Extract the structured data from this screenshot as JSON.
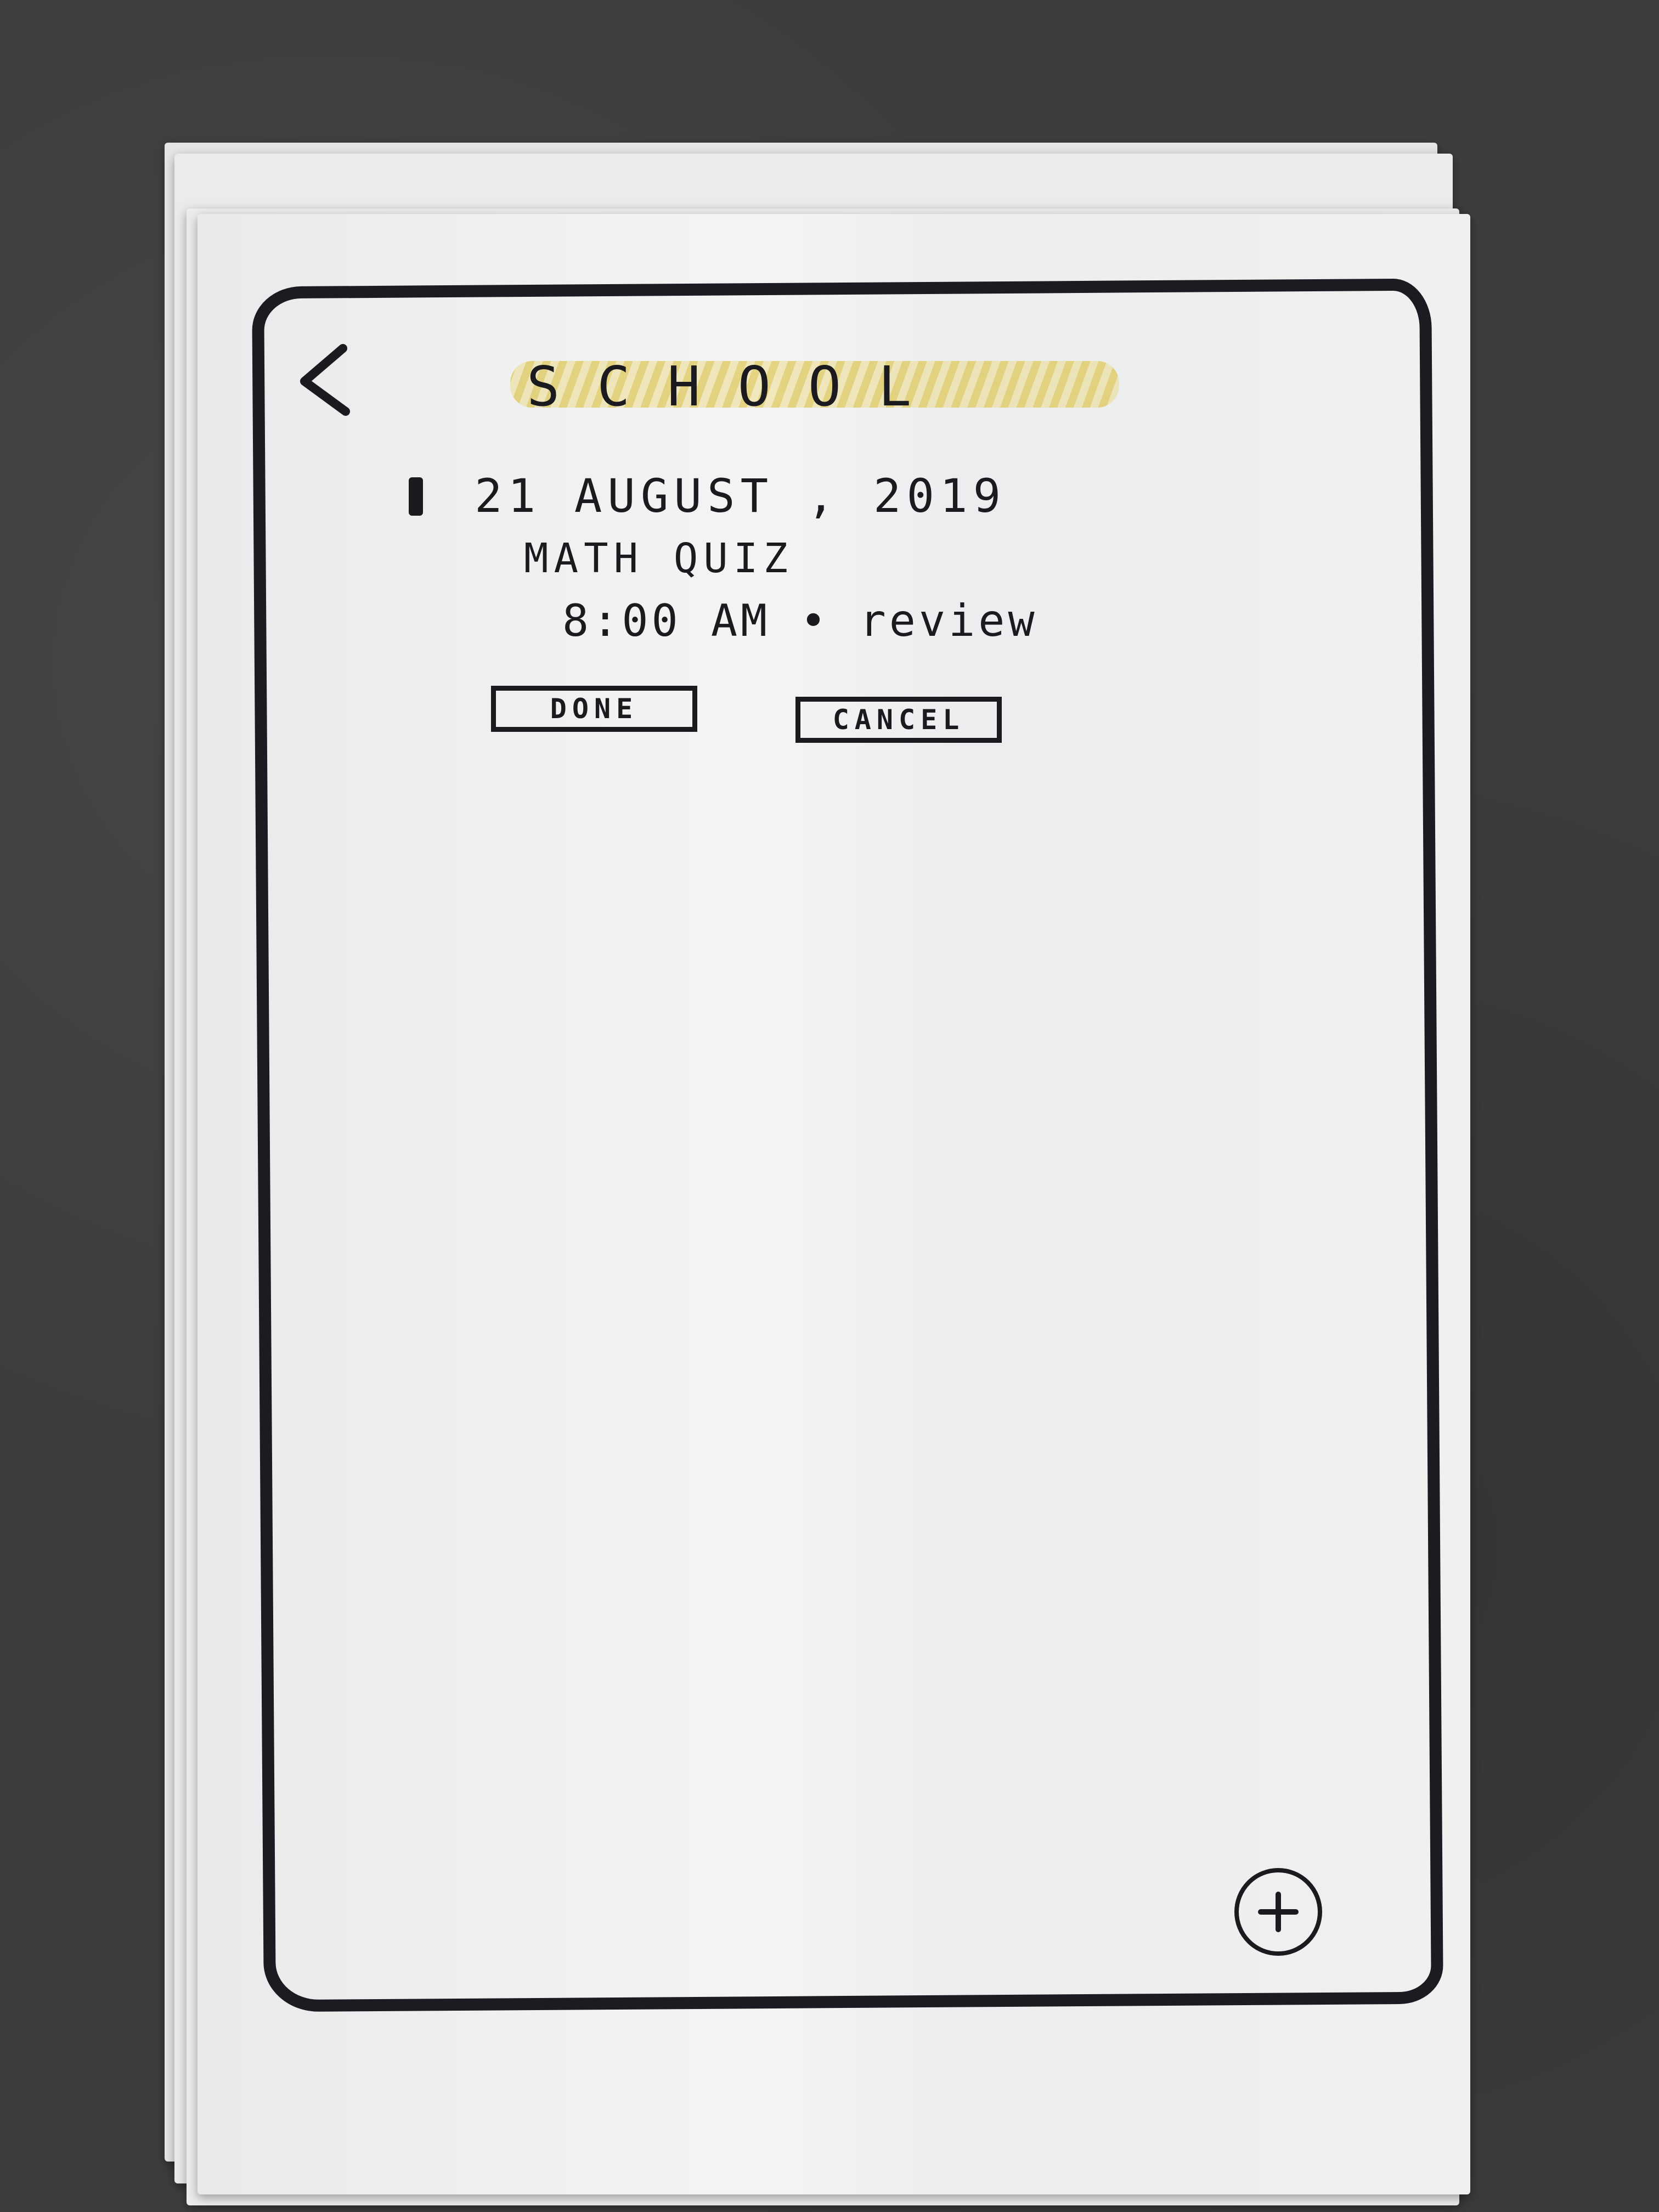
{
  "header": {
    "back_icon": "chevron-left-icon",
    "title": "SCHOOL"
  },
  "entries": [
    {
      "date": "21 AUGUST , 2019",
      "title": "MATH QUIZ",
      "time_detail": "8:00 AM • review"
    }
  ],
  "actions": {
    "done_label": "DONE",
    "cancel_label": "CANCEL"
  },
  "fab": {
    "icon": "plus-icon"
  },
  "colors": {
    "ink": "#1a1a1f",
    "highlight": "#dec85a",
    "paper": "#efefef",
    "background": "#3b3d3e"
  }
}
